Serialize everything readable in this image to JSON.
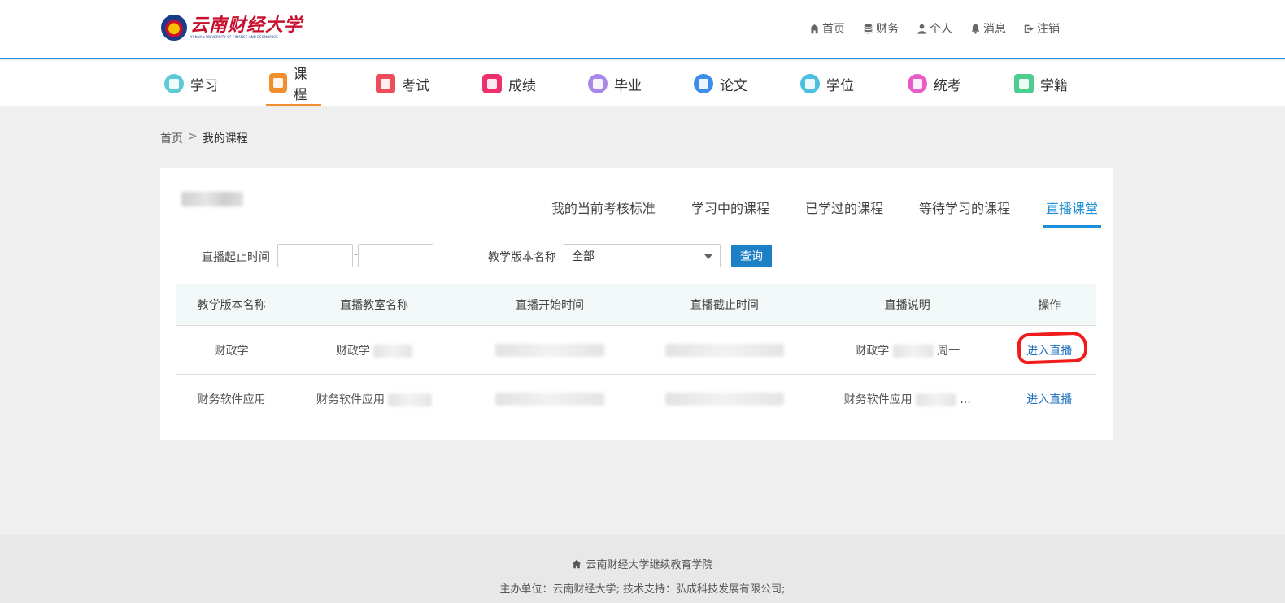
{
  "brand": {
    "logo_cn": "云南财经大学",
    "logo_en": "YUNNAN UNIVERSITY OF FINANCE AND ECONOMICS",
    "accent": "#1e8fd6",
    "logo_red": "#c8102e"
  },
  "toplinks": [
    {
      "label": "首页",
      "icon": "home-icon"
    },
    {
      "label": "财务",
      "icon": "database-icon"
    },
    {
      "label": "个人",
      "icon": "user-icon"
    },
    {
      "label": "消息",
      "icon": "bell-icon"
    },
    {
      "label": "注销",
      "icon": "sign-out-icon"
    }
  ],
  "nav": [
    {
      "label": "学习",
      "icon": "study-icon",
      "color": "#5ec9d6"
    },
    {
      "label": "课程",
      "icon": "course-icon",
      "color": "#f18f2f",
      "active": true
    },
    {
      "label": "考试",
      "icon": "exam-icon",
      "color": "#ee4d5c"
    },
    {
      "label": "成绩",
      "icon": "score-icon",
      "color": "#f0306a"
    },
    {
      "label": "毕业",
      "icon": "graduate-icon",
      "color": "#a987e8"
    },
    {
      "label": "论文",
      "icon": "thesis-icon",
      "color": "#3c8de8"
    },
    {
      "label": "学位",
      "icon": "degree-icon",
      "color": "#4cc0e0"
    },
    {
      "label": "统考",
      "icon": "unified-exam-icon",
      "color": "#e85cc8"
    },
    {
      "label": "学籍",
      "icon": "enrollment-icon",
      "color": "#4ccf8e"
    }
  ],
  "breadcrumb": {
    "home": "首页",
    "sep": ">",
    "current": "我的课程"
  },
  "tabs": [
    {
      "label": "我的当前考核标准"
    },
    {
      "label": "学习中的课程"
    },
    {
      "label": "已学过的课程"
    },
    {
      "label": "等待学习的课程"
    },
    {
      "label": "直播课堂",
      "active": true
    }
  ],
  "filter": {
    "time_label": "直播起止时间",
    "start_value": "",
    "end_value": "",
    "range_sep": "-",
    "version_label": "教学版本名称",
    "version_selected": "全部",
    "query_button": "查询"
  },
  "table": {
    "headers": [
      "教学版本名称",
      "直播教室名称",
      "直播开始时间",
      "直播截止时间",
      "直播说明",
      "操作"
    ],
    "rows": [
      {
        "version": "财政学",
        "classroom": "财政学",
        "desc": "财政学",
        "desc_tail": "周一",
        "action": "进入直播",
        "highlighted": true
      },
      {
        "version": "财务软件应用",
        "classroom": "财务软件应用",
        "desc": "财务软件应用",
        "desc_tail": "...",
        "action": "进入直播",
        "highlighted": false
      }
    ]
  },
  "footer": {
    "line1": "云南财经大学继续教育学院",
    "line2": "主办单位：云南财经大学;   技术支持：弘成科技发展有限公司;"
  }
}
